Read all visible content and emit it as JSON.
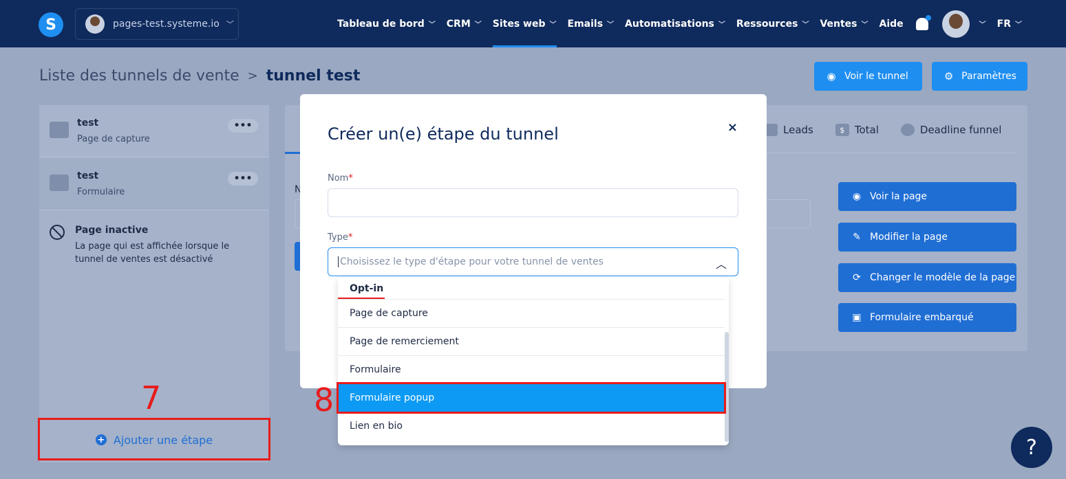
{
  "topbar": {
    "logo": "S",
    "site": "pages-test.systeme.io",
    "nav": [
      "Tableau de bord",
      "CRM",
      "Sites web",
      "Emails",
      "Automatisations",
      "Ressources",
      "Ventes",
      "Aide"
    ],
    "lang": "FR"
  },
  "breadcrumb": {
    "parent": "Liste des tunnels de vente",
    "sep": ">",
    "current": "tunnel test"
  },
  "header_buttons": {
    "voir_tunnel": "Voir le tunnel",
    "parametres": "Paramètres"
  },
  "steps": [
    {
      "title": "test",
      "sub": "Page de capture",
      "more": "•••"
    },
    {
      "title": "test",
      "sub": "Formulaire",
      "more": "•••"
    }
  ],
  "inactive": {
    "title": "Page inactive",
    "desc": "La page qui est affichée lorsque le tunnel de ventes est désactivé"
  },
  "add_step": "Ajouter une étape",
  "annotations": {
    "n7": "7",
    "n8": "8"
  },
  "tabs": [
    {
      "icon": "Lead",
      "label": "Leads"
    },
    {
      "icon": "$",
      "label": "Total"
    },
    {
      "icon": "",
      "label": "Deadline funnel"
    }
  ],
  "fragment_label": "N",
  "side_buttons": [
    "Voir la page",
    "Modifier la page",
    "Changer le modèle de la page",
    "Formulaire embarqué"
  ],
  "modal": {
    "title": "Créer un(e) étape du tunnel",
    "close": "×",
    "nom_label": "Nom",
    "type_label": "Type",
    "req": "*",
    "type_placeholder": "Choisissez le type d'étape pour votre tunnel de ventes"
  },
  "dropdown": {
    "group": "Opt-in",
    "items": [
      "Page de capture",
      "Page de remerciement",
      "Formulaire",
      "Formulaire popup",
      "Lien en bio"
    ],
    "selected": "Formulaire popup"
  },
  "help": "?",
  "colors": {
    "nav_bg": "#0f2a5c",
    "primary": "#1f8ef1",
    "highlight": "#e81b1b",
    "selected": "#0c9af5"
  }
}
